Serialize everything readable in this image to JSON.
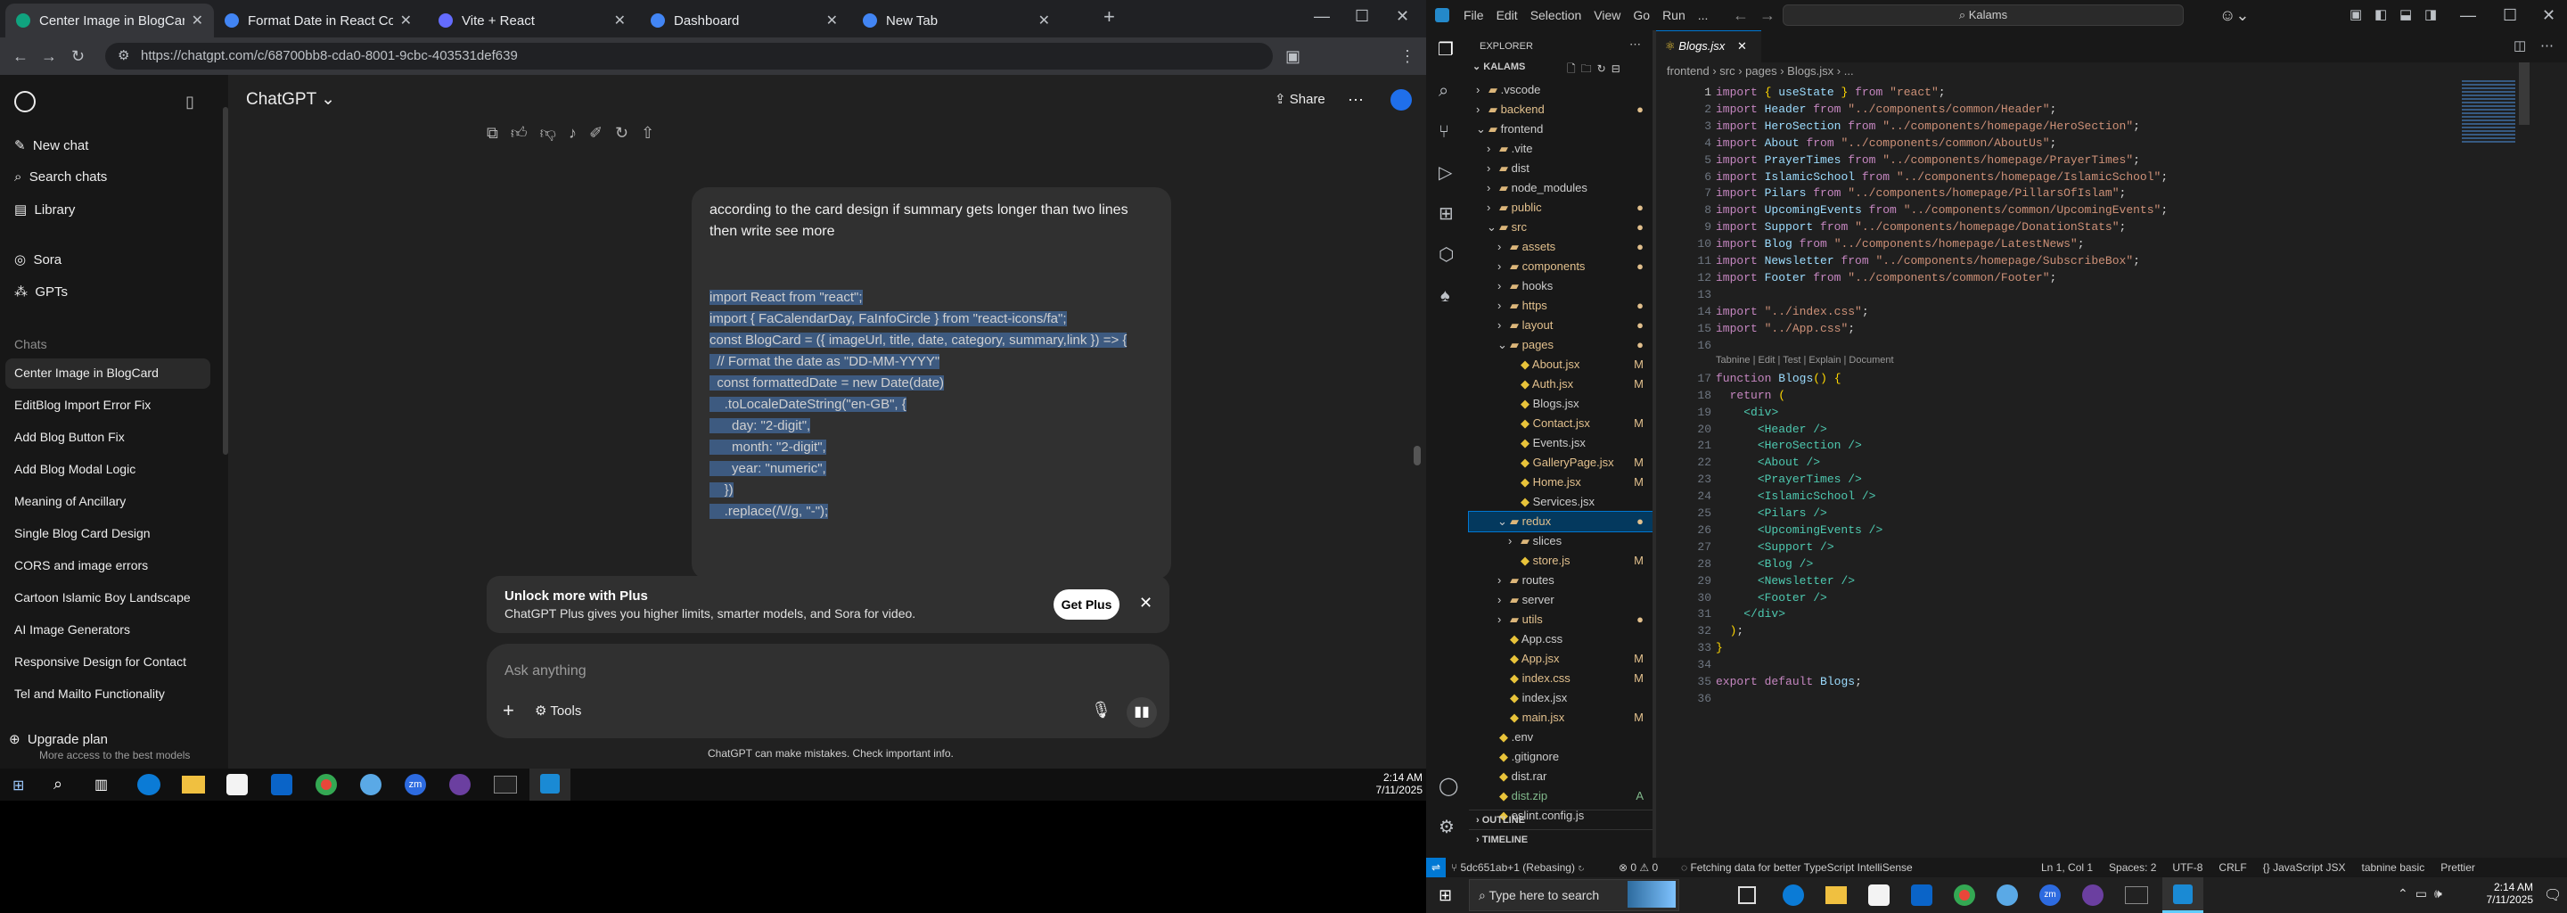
{
  "browser": {
    "tabs": [
      {
        "label": "Center Image in BlogCard",
        "color": "#10a37f",
        "active": true
      },
      {
        "label": "Format Date in React Compone",
        "color": "#4285f4"
      },
      {
        "label": "Vite + React",
        "color": "#646cff"
      },
      {
        "label": "Dashboard",
        "color": "#4285f4"
      },
      {
        "label": "New Tab",
        "color": "#4285f4"
      }
    ],
    "url": "https://chatgpt.com/c/68700bb8-cda0-8001-9cbc-403531def639"
  },
  "chatgpt": {
    "model": "ChatGPT",
    "share": "Share",
    "sidebar": {
      "new_chat": "New chat",
      "search": "Search chats",
      "library": "Library",
      "sora": "Sora",
      "gpts": "GPTs",
      "chats_heading": "Chats",
      "chats": [
        "Center Image in BlogCard",
        "EditBlog Import Error Fix",
        "Add Blog Button Fix",
        "Add Blog Modal Logic",
        "Meaning of Ancillary",
        "Single Blog Card Design",
        "CORS and image errors",
        "Cartoon Islamic Boy Landscape",
        "AI Image Generators",
        "Responsive Design for Contact",
        "Tel and Mailto Functionality"
      ],
      "upgrade": "Upgrade plan",
      "upgrade_sub": "More access to the best models"
    },
    "user_message": "according to the card design if summary gets longer than two lines then write see more",
    "code_lines": [
      "import React from \"react\";",
      "import { FaCalendarDay, FaInfoCircle } from \"react-icons/fa\";",
      "",
      "const BlogCard = ({ imageUrl, title, date, category, summary,link }) => {",
      "",
      "  // Format the date as \"DD-MM-YYYY\"",
      "  const formattedDate = new Date(date)",
      "    .toLocaleDateString(\"en-GB\", {",
      "      day: \"2-digit\",",
      "      month: \"2-digit\",",
      "      year: \"numeric\",",
      "    })",
      "    .replace(/\\//g, \"-\");"
    ],
    "upsell_title": "Unlock more with Plus",
    "upsell_text": "ChatGPT Plus gives you higher limits, smarter models, and Sora for video.",
    "get_plus": "Get Plus",
    "input_placeholder": "Ask anything",
    "tools": "Tools",
    "disclaimer": "ChatGPT can make mistakes. Check important info."
  },
  "taskbar_left": {
    "time": "2:14 AM",
    "date": "7/11/2025"
  },
  "vscode": {
    "menu": [
      "File",
      "Edit",
      "Selection",
      "View",
      "Go",
      "Run",
      "..."
    ],
    "search": "Kalams",
    "explorer_title": "EXPLORER",
    "project": "KALAMS",
    "tree": [
      {
        "n": ".vscode",
        "d": 1,
        "f": 1
      },
      {
        "n": "backend",
        "d": 1,
        "f": 1,
        "m": "dot"
      },
      {
        "n": "frontend",
        "d": 1,
        "f": 1,
        "o": 1
      },
      {
        "n": ".vite",
        "d": 2,
        "f": 1
      },
      {
        "n": "dist",
        "d": 2,
        "f": 1
      },
      {
        "n": "node_modules",
        "d": 2,
        "f": 1
      },
      {
        "n": "public",
        "d": 2,
        "f": 1,
        "m": "dot"
      },
      {
        "n": "src",
        "d": 2,
        "f": 1,
        "o": 1,
        "m": "dot"
      },
      {
        "n": "assets",
        "d": 3,
        "f": 1,
        "m": "dot"
      },
      {
        "n": "components",
        "d": 3,
        "f": 1,
        "m": "dot"
      },
      {
        "n": "hooks",
        "d": 3,
        "f": 1
      },
      {
        "n": "https",
        "d": 3,
        "f": 1,
        "m": "dot"
      },
      {
        "n": "layout",
        "d": 3,
        "f": 1,
        "m": "dot"
      },
      {
        "n": "pages",
        "d": 3,
        "f": 1,
        "o": 1,
        "m": "dot"
      },
      {
        "n": "About.jsx",
        "d": 4,
        "m": "M"
      },
      {
        "n": "Auth.jsx",
        "d": 4,
        "m": "M"
      },
      {
        "n": "Blogs.jsx",
        "d": 4
      },
      {
        "n": "Contact.jsx",
        "d": 4,
        "m": "M"
      },
      {
        "n": "Events.jsx",
        "d": 4
      },
      {
        "n": "GalleryPage.jsx",
        "d": 4,
        "m": "M"
      },
      {
        "n": "Home.jsx",
        "d": 4,
        "m": "M"
      },
      {
        "n": "Services.jsx",
        "d": 4
      },
      {
        "n": "redux",
        "d": 3,
        "f": 1,
        "o": 1,
        "m": "dot",
        "sel": 1
      },
      {
        "n": "slices",
        "d": 4,
        "f": 1
      },
      {
        "n": "store.js",
        "d": 4,
        "m": "M"
      },
      {
        "n": "routes",
        "d": 3,
        "f": 1
      },
      {
        "n": "server",
        "d": 3,
        "f": 1
      },
      {
        "n": "utils",
        "d": 3,
        "f": 1,
        "m": "dot"
      },
      {
        "n": "App.css",
        "d": 3
      },
      {
        "n": "App.jsx",
        "d": 3,
        "m": "M"
      },
      {
        "n": "index.css",
        "d": 3,
        "m": "M"
      },
      {
        "n": "index.jsx",
        "d": 3
      },
      {
        "n": "main.jsx",
        "d": 3,
        "m": "M"
      },
      {
        "n": ".env",
        "d": 2
      },
      {
        "n": ".gitignore",
        "d": 2
      },
      {
        "n": "dist.rar",
        "d": 2
      },
      {
        "n": "dist.zip",
        "d": 2,
        "m": "A"
      },
      {
        "n": "eslint.config.js",
        "d": 2
      }
    ],
    "outline": "OUTLINE",
    "timeline": "TIMELINE",
    "tab": "Blogs.jsx",
    "breadcrumb": [
      "frontend",
      "src",
      "pages",
      "Blogs.jsx",
      "..."
    ],
    "code": [
      "import { useState } from \"react\";",
      "import Header from \"../components/common/Header\";",
      "import HeroSection from \"../components/homepage/HeroSection\";",
      "import About from \"../components/common/AboutUs\";",
      "import PrayerTimes from \"../components/homepage/PrayerTimes\";",
      "import IslamicSchool from \"../components/homepage/IslamicSchool\";",
      "import Pilars from \"../components/homepage/PillarsOfIslam\";",
      "import UpcomingEvents from \"../components/common/UpcomingEvents\";",
      "import Support from \"../components/homepage/DonationStats\";",
      "import Blog from \"../components/homepage/LatestNews\";",
      "import Newsletter from \"../components/homepage/SubscribeBox\";",
      "import Footer from \"../components/common/Footer\";",
      "",
      "import \"../index.css\";",
      "import \"../App.css\";",
      "",
      "function Blogs() {",
      "  return (",
      "    <div>",
      "      <Header />",
      "      <HeroSection />",
      "      <About />",
      "      <PrayerTimes />",
      "      <IslamicSchool />",
      "      <Pilars />",
      "      <UpcomingEvents />",
      "      <Support />",
      "      <Blog />",
      "      <Newsletter />",
      "      <Footer />",
      "    </div>",
      "  );",
      "}",
      "",
      "export default Blogs;",
      ""
    ],
    "codelens": "Tabnine | Edit | Test | Explain | Document",
    "status_left": "5dc651ab+1 (Rebasing)",
    "status_problems": "0 ⚠ 0",
    "status_msg": "Fetching data for better TypeScript IntelliSense",
    "status_right": [
      "Ln 1, Col 1",
      "Spaces: 2",
      "UTF-8",
      "CRLF",
      "{} JavaScript JSX",
      "tabnine basic",
      "Prettier"
    ],
    "search_box": "Type here to search",
    "time": "2:14 AM",
    "date": "7/11/2025"
  }
}
